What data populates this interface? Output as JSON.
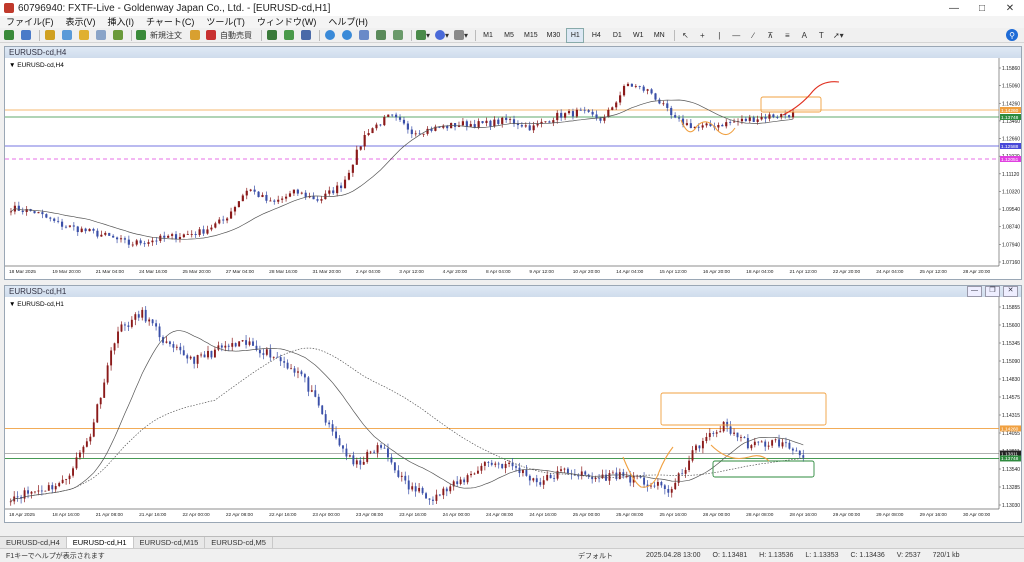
{
  "window": {
    "title": "60796940: FXTF-Live - Goldenway Japan Co., Ltd. - [EURUSD-cd,H1]"
  },
  "menu": {
    "items": [
      "ファイル(F)",
      "表示(V)",
      "挿入(I)",
      "チャート(C)",
      "ツール(T)",
      "ウィンドウ(W)",
      "ヘルプ(H)"
    ]
  },
  "toolbar": {
    "new_order_label": "新規注文",
    "auto_trade_label": "自動売買",
    "timeframes": [
      "M1",
      "M5",
      "M15",
      "M30",
      "H1",
      "H4",
      "D1",
      "W1",
      "MN"
    ]
  },
  "colors": {
    "bull": "#8b1a1a",
    "bear": "#3a4fa8",
    "ma": "#555555",
    "orange": "#f0a040",
    "green": "#2e8b3e",
    "blue": "#4848d8",
    "magenta": "#e040e0"
  },
  "chart_h4": {
    "title": "EURUSD-cd,H4",
    "label": "EURUSD-cd,H4",
    "yaxis": [
      "1.15860",
      "1.15060",
      "1.14260",
      "1.13460",
      "1.12660",
      "1.11920",
      "1.11120",
      "1.10320",
      "1.09540",
      "1.08740",
      "1.07940",
      "1.07160"
    ],
    "xaxis": [
      "18 Mar 2025",
      "19 Mar 20:00",
      "21 Mar 04:00",
      "24 Mar 16:00",
      "25 Mar 20:00",
      "27 Mar 04:00",
      "28 Mar 16:00",
      "31 Mar 20:00",
      "2 Apr 04:00",
      "3 Apr 12:00",
      "4 Apr 20:00",
      "8 Apr 04:00",
      "9 Apr 12:00",
      "10 Apr 20:00",
      "14 Apr 04:00",
      "15 Apr 12:00",
      "16 Apr 20:00",
      "18 Apr 04:00",
      "21 Apr 12:00",
      "22 Apr 20:00",
      "24 Apr 04:00",
      "25 Apr 12:00",
      "28 Apr 20:00"
    ],
    "price_tags": [
      {
        "price": "1.14260",
        "color": "#f0a040"
      },
      {
        "price": "1.13748",
        "color": "#2e8b3e"
      },
      {
        "price": "1.12588",
        "color": "#4848d8"
      },
      {
        "price": "1.12051",
        "color": "#e040e0"
      }
    ]
  },
  "chart_h1": {
    "title": "EURUSD-cd,H1",
    "label": "EURUSD-cd,H1",
    "yaxis": [
      "1.15855",
      "1.15600",
      "1.15345",
      "1.15090",
      "1.14830",
      "1.14575",
      "1.14315",
      "1.14055",
      "1.13811",
      "1.13540",
      "1.13285",
      "1.13030"
    ],
    "xaxis": [
      "18 Apr 2025",
      "18 Apr 16:00",
      "21 Apr 08:00",
      "21 Apr 16:00",
      "22 Apr 00:00",
      "22 Apr 08:00",
      "22 Apr 16:00",
      "23 Apr 00:00",
      "23 Apr 08:00",
      "23 Apr 16:00",
      "24 Apr 00:00",
      "24 Apr 08:00",
      "24 Apr 16:00",
      "25 Apr 00:00",
      "25 Apr 08:00",
      "25 Apr 16:00",
      "28 Apr 00:00",
      "28 Apr 08:00",
      "28 Apr 16:00",
      "29 Apr 00:00",
      "29 Apr 08:00",
      "29 Apr 16:00",
      "30 Apr 00:00"
    ],
    "price_tags": [
      {
        "price": "1.14260",
        "color": "#f0a040"
      },
      {
        "price": "1.13811",
        "color": "#222222"
      },
      {
        "price": "1.13748",
        "color": "#2e8b3e"
      }
    ]
  },
  "tabs": [
    "EURUSD-cd,H4",
    "EURUSD-cd,H1",
    "EURUSD-cd,M15",
    "EURUSD-cd,M5"
  ],
  "active_tab": 1,
  "status": {
    "help": "F1キーでヘルプが表示されます",
    "profile": "デフォルト",
    "datetime": "2025.04.28 13:00",
    "open": "O: 1.13481",
    "high": "H: 1.13536",
    "low": "L: 1.13353",
    "close": "C: 1.13436",
    "volume": "V: 2537",
    "traffic": "720/1 kb"
  }
}
